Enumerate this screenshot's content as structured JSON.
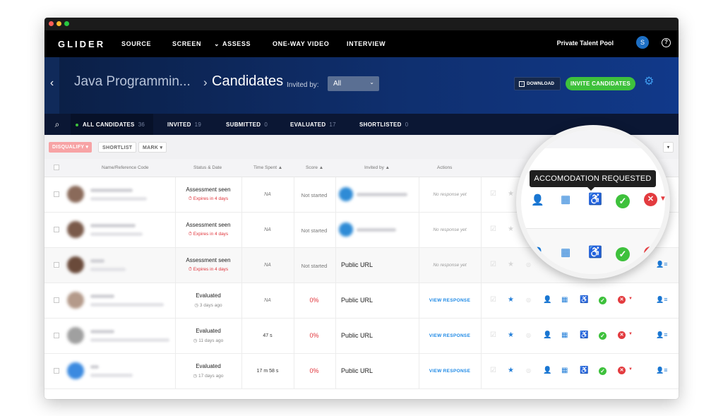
{
  "nav": {
    "brand": "GLIDER",
    "items": [
      "SOURCE",
      "SCREEN",
      "ASSESS",
      "ONE-WAY VIDEO",
      "INTERVIEW"
    ],
    "assess_chevron": "⌄",
    "pool": "Private Talent Pool",
    "avatar_initial": "S",
    "help": "?"
  },
  "header": {
    "back": "‹",
    "project": "Java Programmin...",
    "separator": "›",
    "title": "Candidates",
    "invited_by_label": "Invited by:",
    "invited_by_value": "All",
    "download_label": "DOWNLOAD",
    "invite_label": "INVITE CANDIDATES"
  },
  "tabs": [
    {
      "label": "ALL CANDIDATES",
      "count": "36"
    },
    {
      "label": "INVITED",
      "count": "19"
    },
    {
      "label": "SUBMITTED",
      "count": "0"
    },
    {
      "label": "EVALUATED",
      "count": "17"
    },
    {
      "label": "SHORTLISTED",
      "count": "0"
    }
  ],
  "toolbar": {
    "disqualify": "DISQUALIFY ▾",
    "shortlist": "SHORTLIST",
    "mark": "MARK ▾"
  },
  "columns": {
    "name": "Name/Reference Code",
    "status": "Status & Date",
    "time": "Time Spent ▲",
    "score": "Score ▲",
    "invited_by": "Invited by ▲",
    "actions": "Actions"
  },
  "rows": [
    {
      "status": "Assessment seen",
      "sub": "Expires in 4 days",
      "time": "NA",
      "score": "Not started",
      "invited_by": "",
      "action": "No response yet"
    },
    {
      "status": "Assessment seen",
      "sub": "Expires in 4 days",
      "time": "NA",
      "score": "Not started",
      "invited_by": "",
      "action": "No response yet"
    },
    {
      "status": "Assessment seen",
      "sub": "Expires in 4 days",
      "time": "NA",
      "score": "Not started",
      "invited_by": "Public URL",
      "action": "No response yet"
    },
    {
      "status": "Evaluated",
      "sub": "3 days ago",
      "time": "NA",
      "score": "0%",
      "invited_by": "Public URL",
      "action": "VIEW RESPONSE"
    },
    {
      "status": "Evaluated",
      "sub": "11 days ago",
      "time": "47 s",
      "score": "0%",
      "invited_by": "Public URL",
      "action": "VIEW RESPONSE"
    },
    {
      "status": "Evaluated",
      "sub": "17 days ago",
      "time": "17 m 58 s",
      "score": "0%",
      "invited_by": "Public URL",
      "action": "VIEW RESPONSE"
    }
  ],
  "tooltip": "ACCOMODATION REQUESTED",
  "colors": {
    "accent": "#3ec13c",
    "brand_blue": "#0f2f6e",
    "danger": "#e33b3f",
    "link": "#1f8ae6"
  }
}
